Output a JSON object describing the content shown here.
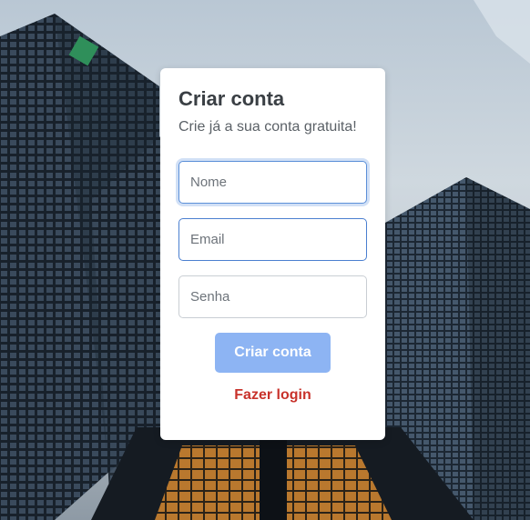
{
  "form": {
    "title": "Criar conta",
    "subtitle": "Crie já a sua conta gratuita!",
    "name_placeholder": "Nome",
    "email_placeholder": "Email",
    "password_placeholder": "Senha",
    "submit_label": "Criar conta",
    "login_link": "Fazer login"
  },
  "colors": {
    "button": "#8db4f3",
    "link": "#c8322b",
    "focus_border": "#5b8fd8"
  }
}
